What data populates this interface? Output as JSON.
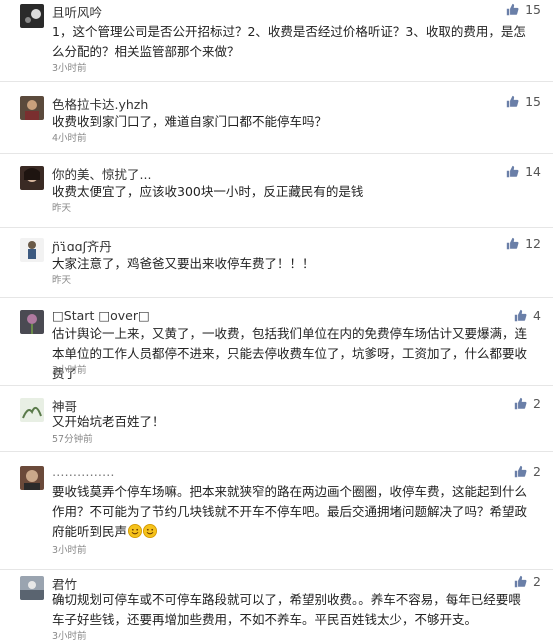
{
  "comments": [
    {
      "user": "且听风吟",
      "likes": "15",
      "time": "3小时前",
      "text": "1，这个管理公司是否公开招标过？2、收费是否经过价格听证？3、收取的费用，是怎么分配的？相关监管部那个来做？"
    },
    {
      "user": "色格拉卡达.yhzh",
      "likes": "15",
      "time": "4小时前",
      "text": "收费收到家门口了，难道自家门口都不能停车吗？"
    },
    {
      "user": "你的美、惊扰了...",
      "likes": "14",
      "time": "昨天",
      "text": "收费太便宜了，应该收300块一小时，反正藏民有的是钱"
    },
    {
      "user": "ɲ̈ɿ̈ɑɑʃ齐丹",
      "likes": "12",
      "time": "昨天",
      "text": "大家注意了，鸡爸爸又要出来收停车费了！！！"
    },
    {
      "user": "□Start □over□",
      "likes": "4",
      "time": "3小时前",
      "text": "估计舆论一上来，又黄了，一收费，包括我们单位在内的免费停车场估计又要爆满，连本单位的工作人员都停不进来，只能去停收费车位了，坑爹呀，工资加了，什么都要收费了"
    },
    {
      "user": "神哥",
      "likes": "2",
      "time": "57分钟前",
      "text": "又开始坑老百姓了！"
    },
    {
      "user": "……………",
      "likes": "2",
      "time": "3小时前",
      "text": "要收钱莫弄个停车场嘛。把本来就狭窄的路在两边画个圈圈，收停车费，这能起到什么作用？不可能为了节约几块钱就不开车不停车吧。最后交通拥堵问题解决了吗？希望政府能听到民声"
    },
    {
      "user": "君竹",
      "likes": "2",
      "time": "3小时前",
      "text": "确切规划可停车或不可停车路段就可以了，希望别收费。。养车不容易，每年已经要喂车子好些钱，还要再增加些费用，不如不养车。平民百姓钱太少，不够开支。"
    }
  ],
  "colors": {
    "like_icon": "#6a7fa8"
  },
  "icons": {
    "like": "thumbs-up-icon",
    "emoji": "smile-emoji-icon"
  }
}
